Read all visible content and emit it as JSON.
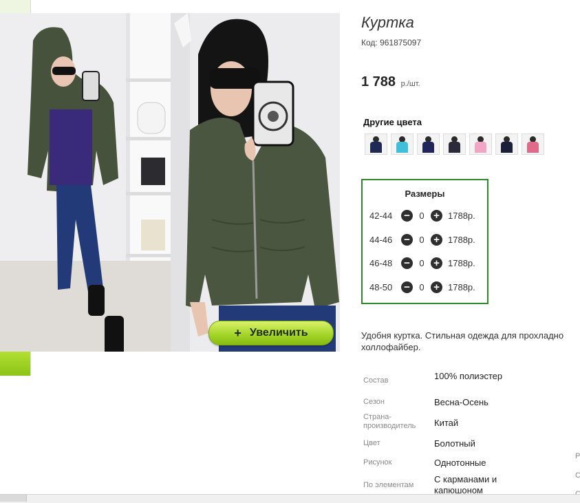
{
  "product": {
    "title": "Куртка",
    "code": "Код: 961875097",
    "price": "1 788",
    "price_unit": "р./шт."
  },
  "gallery": {
    "zoom_label": "Увеличить",
    "zoom_plus": "+"
  },
  "other_colors": {
    "title": "Другие цвета",
    "swatch_colors": [
      "#1e2a55",
      "#3fbfd8",
      "#20265a",
      "#2a2a3a",
      "#f2a6c6",
      "#1b1f3a",
      "#e06a8a"
    ]
  },
  "sizes": {
    "title": "Размеры",
    "rows": [
      {
        "label": "42-44",
        "qty": "0",
        "price": "1788р."
      },
      {
        "label": "44-46",
        "qty": "0",
        "price": "1788р."
      },
      {
        "label": "46-48",
        "qty": "0",
        "price": "1788р."
      },
      {
        "label": "48-50",
        "qty": "0",
        "price": "1788р."
      }
    ],
    "minus": "−",
    "plus": "+"
  },
  "description": {
    "line1": "Удобня куртка. Стильная одежда для прохладно",
    "line2": "холлофайбер."
  },
  "properties": [
    {
      "key": "Состав",
      "value": "100% полиэстер"
    },
    {
      "key": "Сезон",
      "value": "Весна-Осень"
    },
    {
      "key": "Страна-производитель",
      "value": "Китай"
    },
    {
      "key": "Цвет",
      "value": "Болотный"
    },
    {
      "key": "Рисунок",
      "value": "Однотонные"
    },
    {
      "key": "По элементам",
      "value": "С карманами и капюшоном"
    }
  ],
  "edge_letters": [
    "Р",
    "С",
    "С"
  ],
  "colors": {
    "jacket": "#4a5640",
    "accent_green": "#8ac414",
    "sizes_border": "#2c8a2c"
  }
}
